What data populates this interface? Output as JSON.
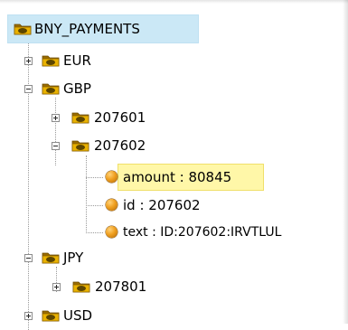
{
  "tree": {
    "root": {
      "label": "BNY_PAYMENTS",
      "icon": "folder-icon"
    },
    "nodes": {
      "eur": {
        "label": "EUR",
        "state": "collapsed"
      },
      "gbp": {
        "label": "GBP",
        "state": "expanded"
      },
      "gbp_207601": {
        "label": "207601",
        "state": "collapsed"
      },
      "gbp_207602": {
        "label": "207602",
        "state": "expanded"
      },
      "jpy": {
        "label": "JPY",
        "state": "expanded"
      },
      "jpy_207801": {
        "label": "207801",
        "state": "collapsed"
      },
      "usd": {
        "label": "USD",
        "state": "collapsed"
      }
    },
    "leaves": {
      "amount": {
        "label": "amount : 80845",
        "icon": "leaf-node-icon",
        "highlighted": true
      },
      "id": {
        "label": "id : 207602",
        "icon": "leaf-node-icon"
      },
      "text": {
        "label": "text : ID:207602:IRVTLUL",
        "icon": "leaf-node-icon"
      }
    }
  },
  "colors": {
    "root_highlight": "#cbe8f6",
    "leaf_highlight": "#fff7a8",
    "folder_gold": "#e9b200"
  }
}
